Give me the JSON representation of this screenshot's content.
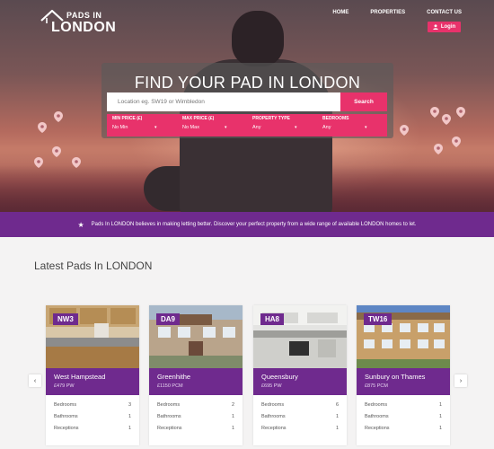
{
  "brand": {
    "line1": "PADS IN",
    "line2": "LONDON"
  },
  "nav": [
    "HOME",
    "PROPERTIES",
    "CONTACT US"
  ],
  "login_label": "Login",
  "search": {
    "title": "FIND YOUR PAD IN LONDON",
    "placeholder": "Location eg. SW19 or Wimbledon",
    "button": "Search",
    "filters": [
      {
        "label": "MIN PRICE (£)",
        "value": "No Min"
      },
      {
        "label": "MAX PRICE (£)",
        "value": "No Max"
      },
      {
        "label": "PROPERTY TYPE",
        "value": "Any"
      },
      {
        "label": "BEDROOMS",
        "value": "Any"
      }
    ]
  },
  "info_bar": "Pads In LONDON believes in making letting better. Discover your perfect property from a wide range of available LONDON homes to let.",
  "latest": {
    "title": "Latest Pads In LONDON",
    "prev": "‹",
    "next": "›",
    "cards": [
      {
        "code": "NW3",
        "name": "West Hampstead",
        "price": "£479 PW",
        "bedrooms": "3",
        "bathrooms": "1",
        "receptions": "1"
      },
      {
        "code": "DA9",
        "name": "Greenhithe",
        "price": "£1150 PCM",
        "bedrooms": "2",
        "bathrooms": "1",
        "receptions": "1"
      },
      {
        "code": "HA8",
        "name": "Queensbury",
        "price": "£695 PW",
        "bedrooms": "6",
        "bathrooms": "1",
        "receptions": "1"
      },
      {
        "code": "TW16",
        "name": "Sunbury on Thames",
        "price": "£875 PCM",
        "bedrooms": "1",
        "bathrooms": "1",
        "receptions": "1"
      }
    ],
    "row_labels": {
      "bedrooms": "Bedrooms",
      "bathrooms": "Bathrooms",
      "receptions": "Receptions"
    }
  },
  "colors": {
    "primary_pink": "#e8326b",
    "primary_purple": "#6f2a8e"
  }
}
